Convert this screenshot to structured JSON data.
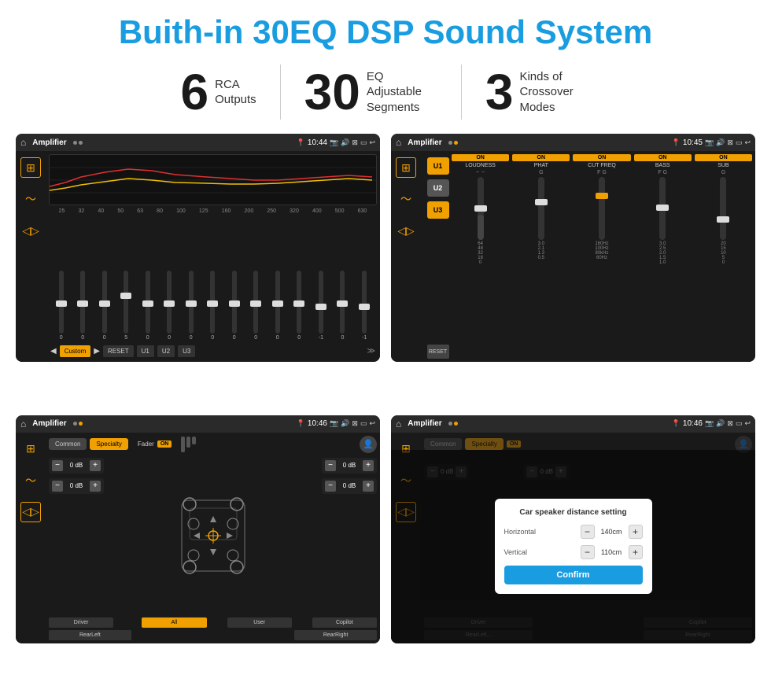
{
  "title": "Buith-in 30EQ DSP Sound System",
  "stats": [
    {
      "number": "6",
      "text": "RCA\nOutputs"
    },
    {
      "number": "30",
      "text": "EQ Adjustable\nSegments"
    },
    {
      "number": "3",
      "text": "Kinds of\nCrossover Modes"
    }
  ],
  "screens": [
    {
      "id": "eq-screen",
      "statusBar": {
        "title": "Amplifier",
        "time": "10:44"
      },
      "type": "eq"
    },
    {
      "id": "crossover-screen",
      "statusBar": {
        "title": "Amplifier",
        "time": "10:45"
      },
      "type": "crossover"
    },
    {
      "id": "fader-screen",
      "statusBar": {
        "title": "Amplifier",
        "time": "10:46"
      },
      "type": "fader"
    },
    {
      "id": "dialog-screen",
      "statusBar": {
        "title": "Amplifier",
        "time": "10:46"
      },
      "type": "fader-dialog"
    }
  ],
  "eq": {
    "frequencies": [
      "25",
      "32",
      "40",
      "50",
      "63",
      "80",
      "100",
      "125",
      "160",
      "200",
      "250",
      "320",
      "400",
      "500",
      "630"
    ],
    "values": [
      "0",
      "0",
      "0",
      "5",
      "0",
      "0",
      "0",
      "0",
      "0",
      "0",
      "0",
      "0",
      "-1",
      "0",
      "-1"
    ],
    "preset": "Custom",
    "buttons": [
      "RESET",
      "U1",
      "U2",
      "U3"
    ]
  },
  "crossover": {
    "channels": [
      "LOUDNESS",
      "PHAT",
      "CUT FREQ",
      "BASS",
      "SUB"
    ],
    "uButtons": [
      "U1",
      "U2",
      "U3"
    ]
  },
  "fader": {
    "tabs": [
      "Common",
      "Specialty"
    ],
    "activeTab": "Specialty",
    "label": "Fader",
    "onLabel": "ON",
    "dbValues": [
      "0 dB",
      "0 dB",
      "0 dB",
      "0 dB"
    ],
    "bottomBtns": [
      "Driver",
      "All",
      "User",
      "RearLeft",
      "Copilot",
      "RearRight"
    ]
  },
  "dialog": {
    "title": "Car speaker distance setting",
    "rows": [
      {
        "label": "Horizontal",
        "value": "140cm"
      },
      {
        "label": "Vertical",
        "value": "110cm"
      }
    ],
    "confirmLabel": "Confirm"
  }
}
